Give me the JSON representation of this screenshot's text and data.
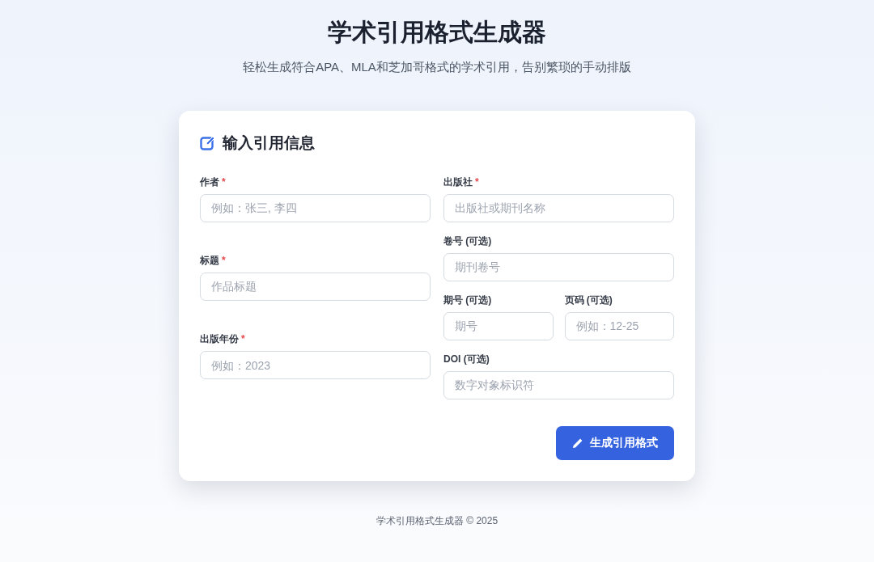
{
  "header": {
    "title": "学术引用格式生成器",
    "subtitle": "轻松生成符合APA、MLA和芝加哥格式的学术引用，告别繁琐的手动排版"
  },
  "form": {
    "title": "输入引用信息",
    "columns": [
      {
        "rows": [
          {
            "kind": "single",
            "fields": [
              {
                "label": "作者",
                "required_mark": "*",
                "placeholder": "例如：张三, 李四"
              }
            ]
          },
          {
            "kind": "single",
            "fields": [
              {
                "label": "标题",
                "required_mark": "*",
                "placeholder": "作品标题"
              }
            ]
          },
          {
            "kind": "single",
            "fields": [
              {
                "label": "出版年份",
                "required_mark": "*",
                "placeholder": "例如：2023"
              }
            ]
          }
        ]
      },
      {
        "rows": [
          {
            "kind": "single",
            "fields": [
              {
                "label": "出版社",
                "required_mark": "*",
                "placeholder": "出版社或期刊名称"
              }
            ]
          },
          {
            "kind": "single",
            "fields": [
              {
                "label": "卷号 (可选)",
                "placeholder": "期刊卷号"
              }
            ]
          },
          {
            "kind": "pair",
            "fields": [
              {
                "label": "期号 (可选)",
                "placeholder": "期号"
              },
              {
                "label": "页码 (可选)",
                "placeholder": "例如：12-25"
              }
            ]
          },
          {
            "kind": "single",
            "fields": [
              {
                "label": "DOI (可选)",
                "placeholder": "数字对象标识符"
              }
            ]
          }
        ]
      }
    ],
    "submit": "生成引用格式"
  },
  "footer": "学术引用格式生成器 © 2025"
}
